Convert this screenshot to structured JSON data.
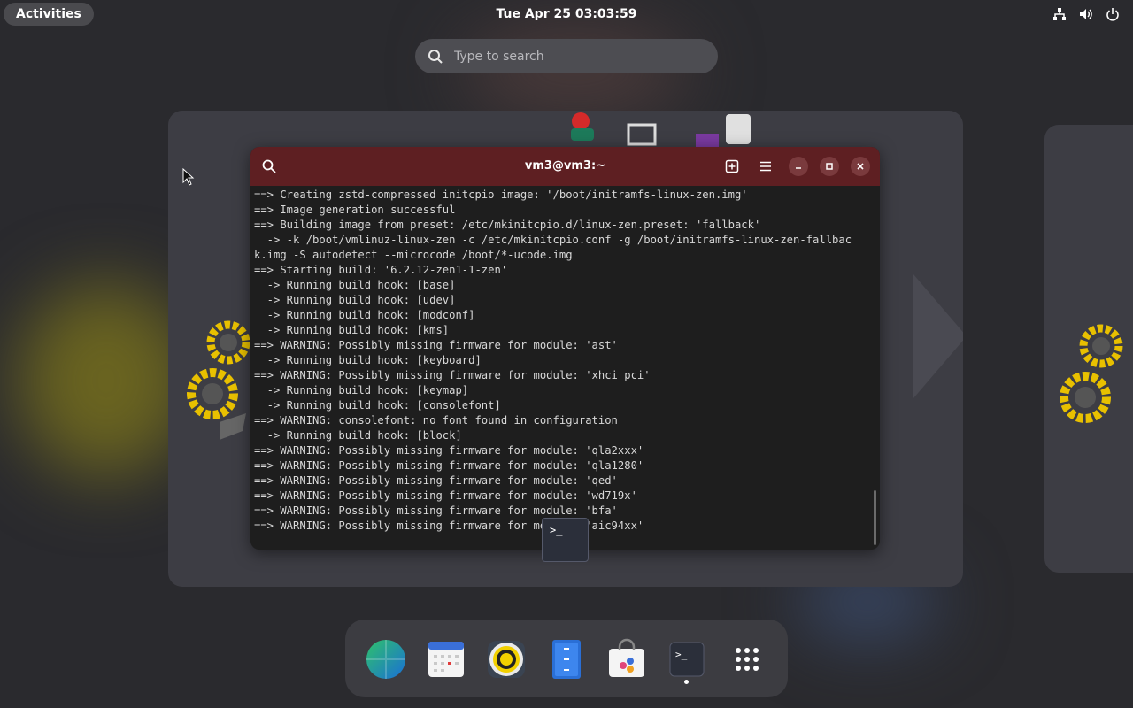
{
  "topbar": {
    "activities_label": "Activities",
    "clock": "Tue Apr 25  03:03:59",
    "tray_icons": [
      "network-icon",
      "volume-icon",
      "power-icon"
    ]
  },
  "search": {
    "placeholder": "Type to search"
  },
  "terminal": {
    "title": "vm3@vm3:~",
    "header_icons": [
      "search-icon",
      "new-tab-icon",
      "menu-icon",
      "minimize-icon",
      "maximize-icon",
      "close-icon"
    ],
    "lines": [
      "==> Creating zstd-compressed initcpio image: '/boot/initramfs-linux-zen.img'",
      "==> Image generation successful",
      "==> Building image from preset: /etc/mkinitcpio.d/linux-zen.preset: 'fallback'",
      "  -> -k /boot/vmlinuz-linux-zen -c /etc/mkinitcpio.conf -g /boot/initramfs-linux-zen-fallbac",
      "k.img -S autodetect --microcode /boot/*-ucode.img",
      "==> Starting build: '6.2.12-zen1-1-zen'",
      "  -> Running build hook: [base]",
      "  -> Running build hook: [udev]",
      "  -> Running build hook: [modconf]",
      "  -> Running build hook: [kms]",
      "==> WARNING: Possibly missing firmware for module: 'ast'",
      "  -> Running build hook: [keyboard]",
      "==> WARNING: Possibly missing firmware for module: 'xhci_pci'",
      "  -> Running build hook: [keymap]",
      "  -> Running build hook: [consolefont]",
      "==> WARNING: consolefont: no font found in configuration",
      "  -> Running build hook: [block]",
      "==> WARNING: Possibly missing firmware for module: 'qla2xxx'",
      "==> WARNING: Possibly missing firmware for module: 'qla1280'",
      "==> WARNING: Possibly missing firmware for module: 'qed'",
      "==> WARNING: Possibly missing firmware for module: 'wd719x'",
      "==> WARNING: Possibly missing firmware for module: 'bfa'",
      "==> WARNING: Possibly missing firmware for module: 'aic94xx'"
    ],
    "thumbnail_prompt": ">_"
  },
  "dock": {
    "items": [
      {
        "name": "browser-icon"
      },
      {
        "name": "calendar-icon"
      },
      {
        "name": "music-player-icon"
      },
      {
        "name": "files-icon"
      },
      {
        "name": "software-store-icon"
      },
      {
        "name": "terminal-icon",
        "label": ">_",
        "running": true
      },
      {
        "name": "app-grid-icon"
      }
    ]
  },
  "colors": {
    "terminal_header": "#5e1f22",
    "terminal_bg": "#1e1e1e",
    "desktop_bg": "#2a2a2e"
  }
}
